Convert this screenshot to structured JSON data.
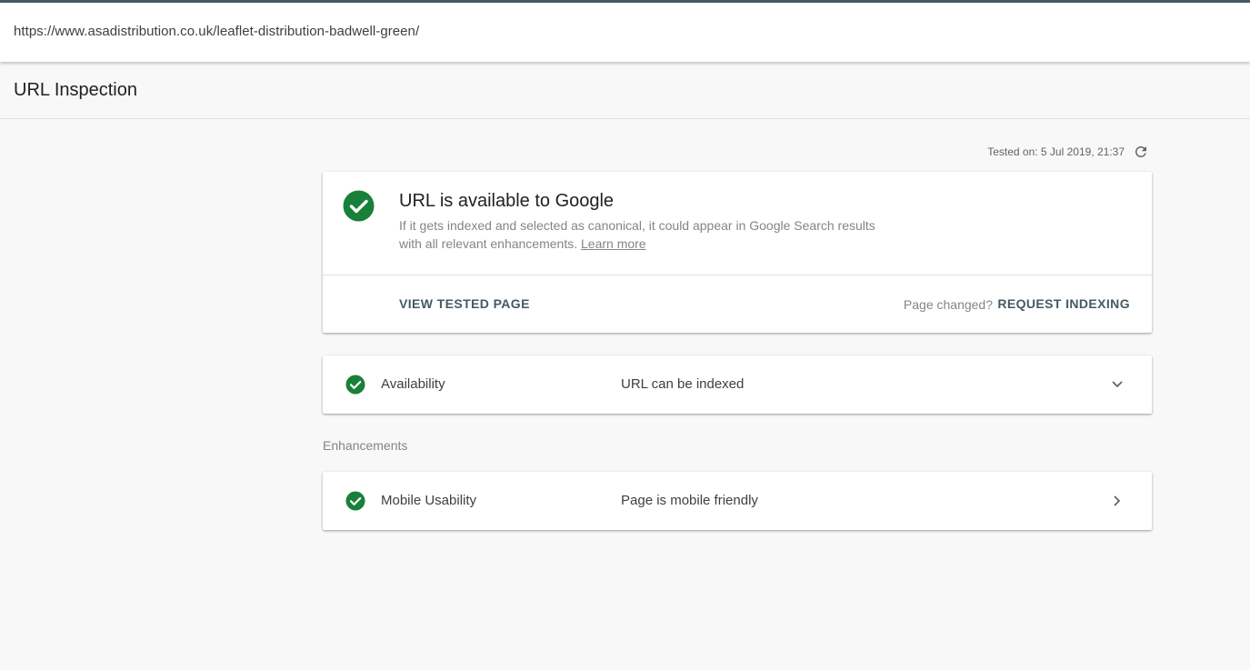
{
  "url_bar": {
    "url": "https://www.asadistribution.co.uk/leaflet-distribution-badwell-green/"
  },
  "header": {
    "title": "URL Inspection"
  },
  "test_info": {
    "tested_on": "Tested on: 5 Jul 2019, 21:37",
    "refresh_icon": "refresh-icon"
  },
  "main_card": {
    "status_icon": "check-circle-icon",
    "title": "URL is available to Google",
    "description_line1": "If it gets indexed and selected as canonical, it could appear in Google Search results",
    "description_line2": "with all relevant enhancements.",
    "learn_more": "Learn more",
    "view_tested_page": "VIEW TESTED PAGE",
    "page_changed": "Page changed?",
    "request_indexing": "REQUEST INDEXING"
  },
  "availability": {
    "icon": "check-circle-icon",
    "label": "Availability",
    "value": "URL can be indexed",
    "chevron": "chevron-down-icon"
  },
  "enhancements": {
    "section_label": "Enhancements",
    "items": [
      {
        "icon": "check-circle-icon",
        "label": "Mobile Usability",
        "value": "Page is mobile friendly",
        "chevron": "chevron-right-icon"
      }
    ]
  },
  "colors": {
    "success_green": "#188038",
    "action_text": "#455a64",
    "top_border": "#455a64",
    "page_background": "#f8f8f8"
  }
}
